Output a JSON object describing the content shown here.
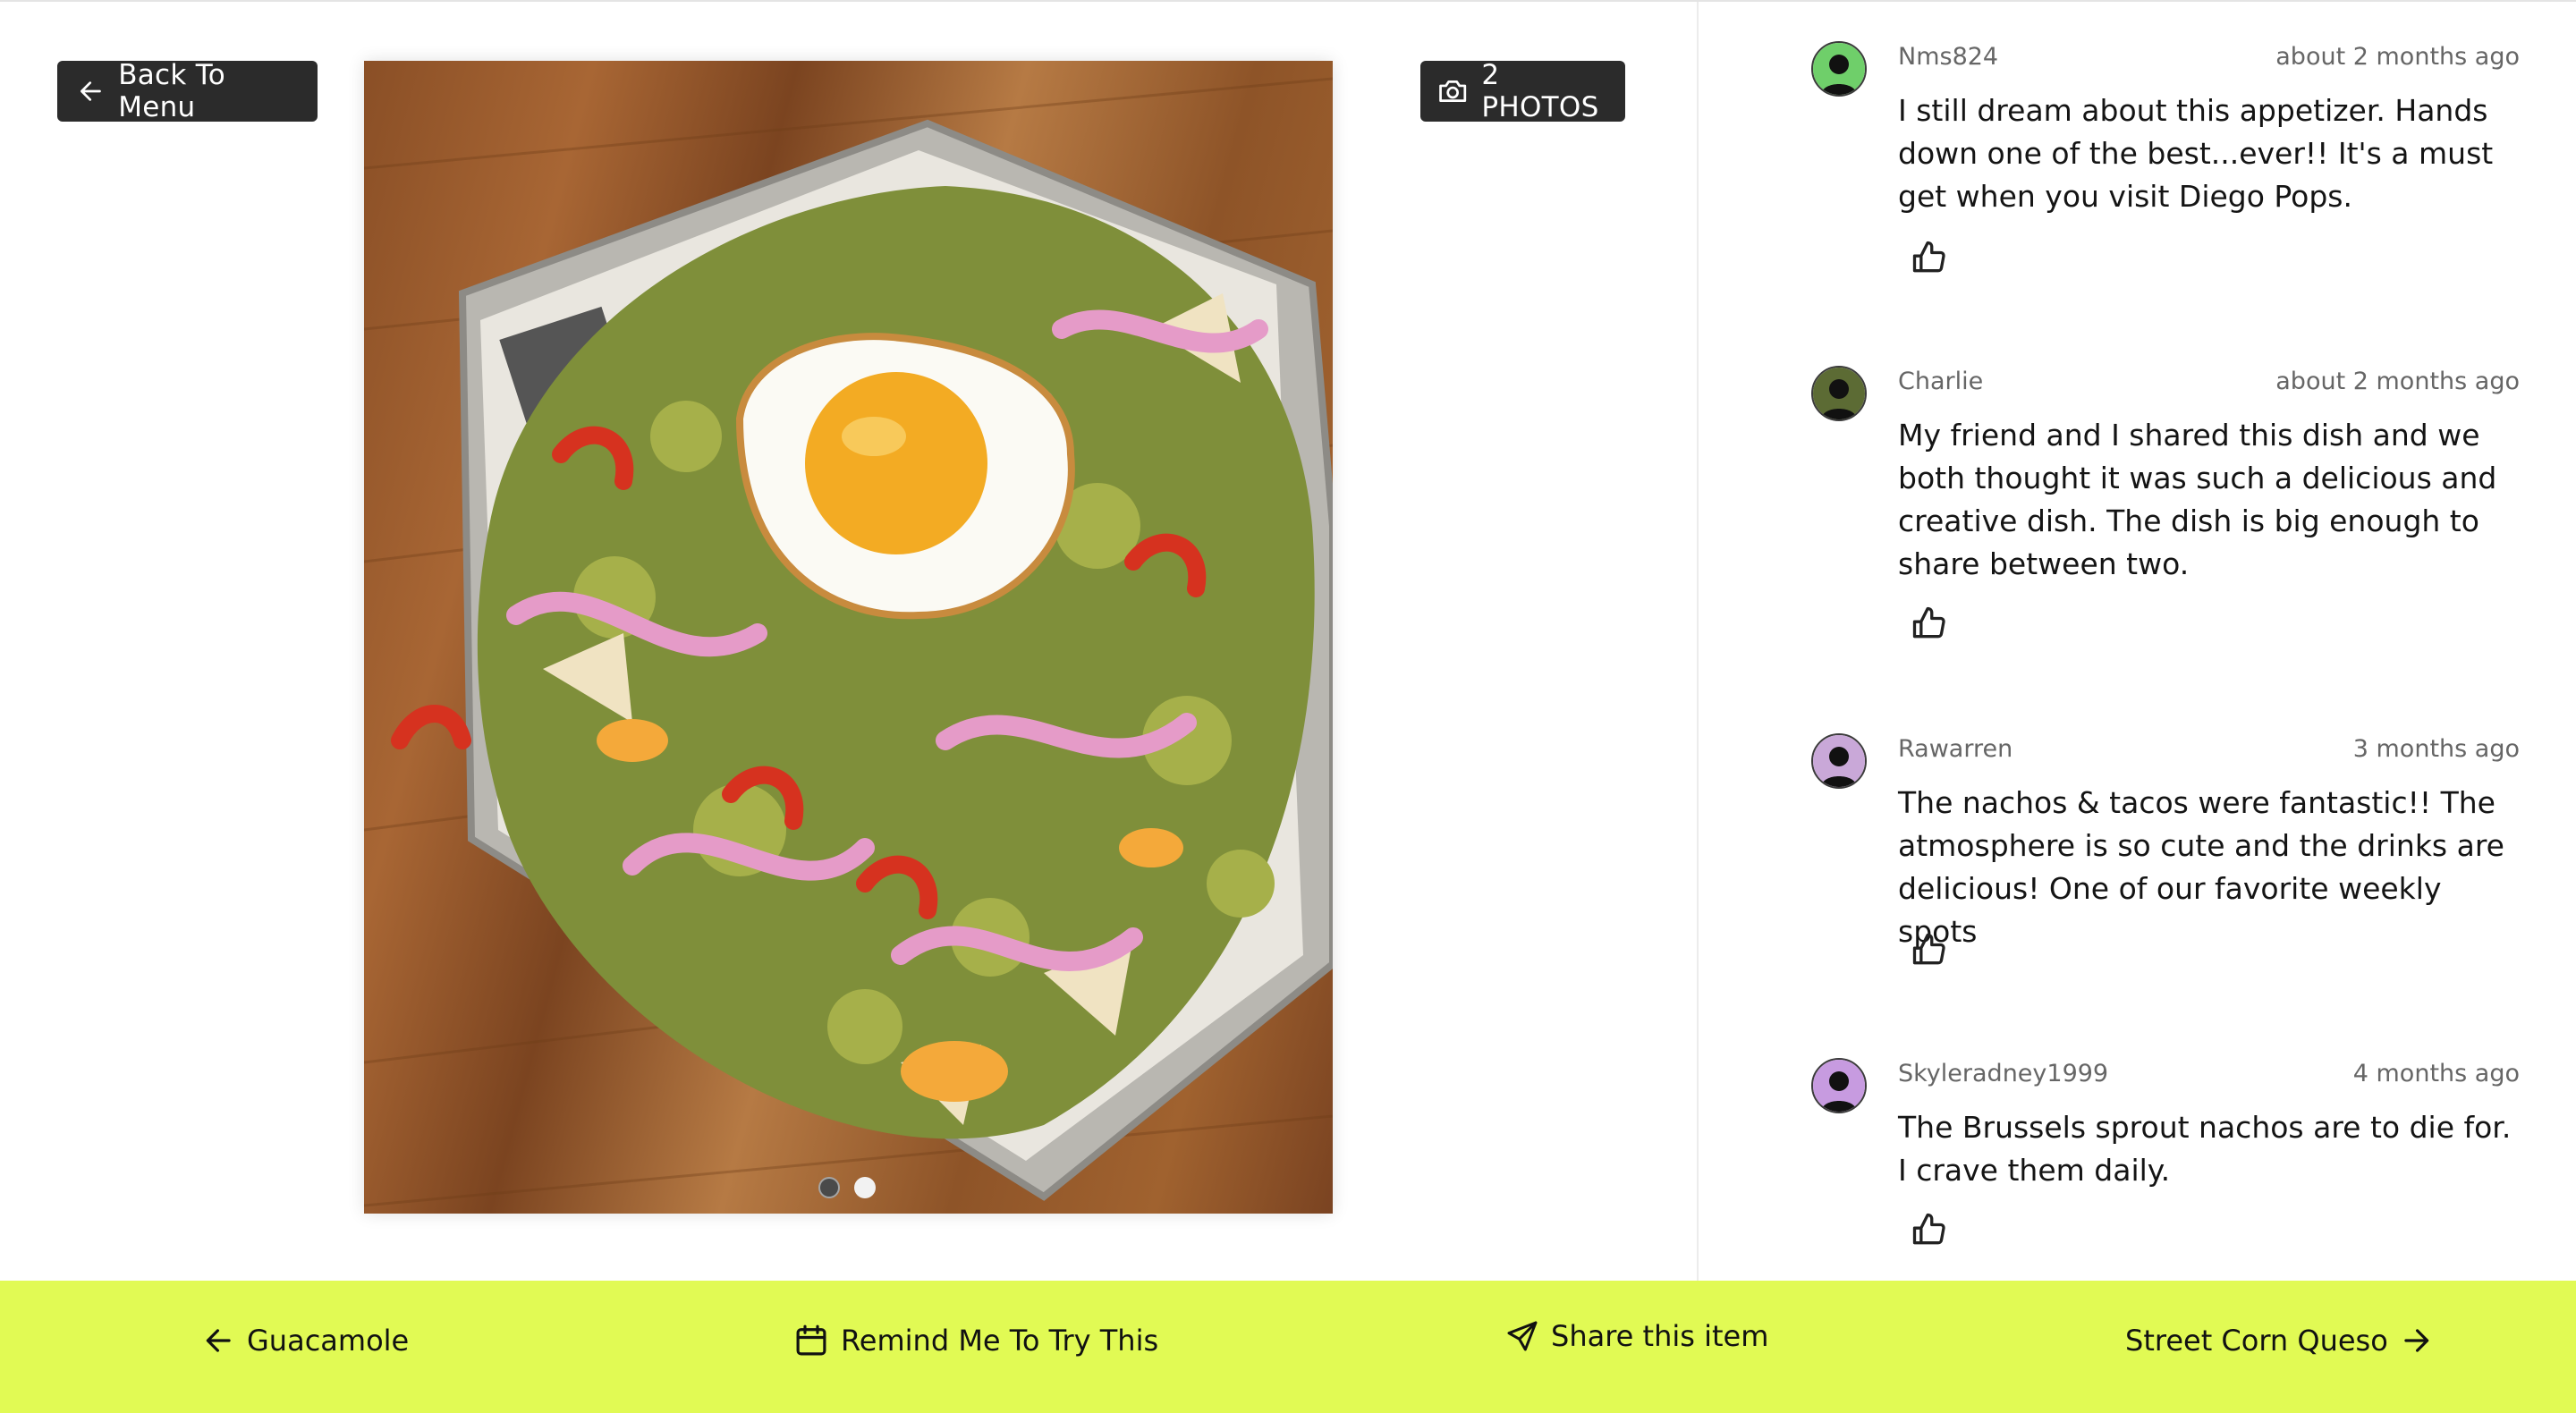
{
  "header": {
    "back_label": "Back To Menu",
    "photos_label": "2 PHOTOS"
  },
  "gallery": {
    "photo_count": 2,
    "active_index": 2
  },
  "reviews": [
    {
      "author": "Nms824",
      "time": "about 2 months ago",
      "text": "I still dream about this appetizer. Hands down one of the best...ever!! It's a must get when you visit Diego Pops.",
      "avatar_color": "#6fcf6a"
    },
    {
      "author": "Charlie",
      "time": "about 2 months ago",
      "text": "My friend and I shared this dish and we both thought it was such a delicious and creative dish. The dish is big enough to share between two.",
      "avatar_color": "#5c6b34"
    },
    {
      "author": "Rawarren",
      "time": "3 months ago",
      "text": "The nachos & tacos were fantastic!! The atmosphere is so cute and the drinks are delicious! One of our favorite weekly spots",
      "avatar_color": "#c9a8d8"
    },
    {
      "author": "Skyleradney1999",
      "time": "4 months ago",
      "text": "The Brussels sprout nachos are to die for. I crave them daily.",
      "avatar_color": "#c79be0"
    }
  ],
  "footer": {
    "prev_label": "Guacamole",
    "remind_label": "Remind Me To Try This",
    "share_label": "Share this item",
    "next_label": "Street Corn Queso"
  },
  "colors": {
    "accent_bar": "#e1fa54",
    "button_dark": "#2b2b2b"
  }
}
